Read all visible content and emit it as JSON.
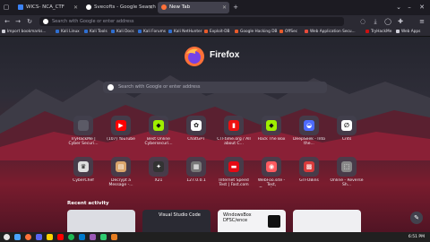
{
  "tabs": [
    {
      "label": "WICS- NCA_CTF",
      "color": "#3b82f6"
    },
    {
      "label": "Svecofts - Google Search",
      "color": "#ffffff"
    },
    {
      "label": "New Tab",
      "color": "#ff7139"
    }
  ],
  "navbar": {
    "url_placeholder": "Search with Google or enter address"
  },
  "bookmarks": [
    {
      "label": "Import bookmarks...",
      "color": "#cfcfd8"
    },
    {
      "label": "Kali Linux",
      "color": "#2f6fd1"
    },
    {
      "label": "Kali Tools",
      "color": "#2f6fd1"
    },
    {
      "label": "Kali Docs",
      "color": "#2f6fd1"
    },
    {
      "label": "Kali Forums",
      "color": "#2f6fd1"
    },
    {
      "label": "Kali NetHunter",
      "color": "#2f6fd1"
    },
    {
      "label": "Exploit-DB",
      "color": "#e85b2b"
    },
    {
      "label": "Google Hacking DB",
      "color": "#e85b2b"
    },
    {
      "label": "OffSec",
      "color": "#e85b2b"
    },
    {
      "label": "Web Application Secu...",
      "color": "#e74c3c"
    },
    {
      "label": "TryHackMe",
      "color": "#c11"
    },
    {
      "label": "Web Apps",
      "color": "#cfcfd8"
    }
  ],
  "home": {
    "brand": "Firefox",
    "search_placeholder": "Search with Google or enter address",
    "recent_title": "Recent activity",
    "recent_cards": [
      {
        "label": ""
      },
      {
        "label": "Visual Studio Code"
      },
      {
        "label": "WindowsBox DFSC/ence"
      },
      {
        "label": ""
      }
    ]
  },
  "shortcuts_row1": [
    {
      "label": "TryHackMe | Cyber Securi...",
      "icon": "tryhackme-icon",
      "color": "#5b5a66",
      "glyph": ""
    },
    {
      "label": "(107) YouTube",
      "icon": "youtube-icon",
      "color": "#ff0000",
      "glyph": "▶"
    },
    {
      "label": "Best Online Cybersecuri...",
      "icon": "hackthebox-icon",
      "color": "#9fef00",
      "glyph": "◆"
    },
    {
      "label": "ChatGPT",
      "icon": "chatgpt-icon",
      "color": "#ffffff",
      "glyph": "✿"
    },
    {
      "label": "CTFtime.org / All about C...",
      "icon": "ctftime-icon",
      "color": "#e11",
      "glyph": "▮"
    },
    {
      "label": "Hack The Box",
      "icon": "hackthebox-icon",
      "color": "#9fef00",
      "glyph": "◆"
    },
    {
      "label": "DeepSeek - Into the...",
      "icon": "deepseek-icon",
      "color": "#4d6bfe",
      "glyph": "◒"
    },
    {
      "label": "Crits",
      "icon": "crits-icon",
      "color": "#ffffff",
      "glyph": "∅"
    }
  ],
  "shortcuts_row2": [
    {
      "label": "CyberChef",
      "icon": "cyberchef-icon",
      "color": "#dddddd",
      "glyph": "♛"
    },
    {
      "label": "Decrypt a Message -...",
      "icon": "decrypt-icon",
      "color": "#d9a56b",
      "glyph": "▤"
    },
    {
      "label": "X21",
      "icon": "x21-icon",
      "color": "#333333",
      "glyph": "✦"
    },
    {
      "label": "127.0.0.1",
      "icon": "localhost-icon",
      "color": "#777777",
      "glyph": "▦"
    },
    {
      "label": "Internet Speed Test | Fast.com",
      "icon": "fastcom-icon",
      "color": "#e50914",
      "glyph": "▬"
    },
    {
      "label": "WebFoo.site - Test, Transform...",
      "icon": "webfoo-icon",
      "color": "#ff5a5f",
      "glyph": "◉"
    },
    {
      "label": "GTFOBins",
      "icon": "gtfobins-icon",
      "color": "#d83b3b",
      "glyph": "▩"
    },
    {
      "label": "Online - Reverse Sh...",
      "icon": "revshell-icon",
      "color": "#888888",
      "glyph": "⬚"
    }
  ],
  "taskbar": {
    "clock": "6:51 PM"
  }
}
